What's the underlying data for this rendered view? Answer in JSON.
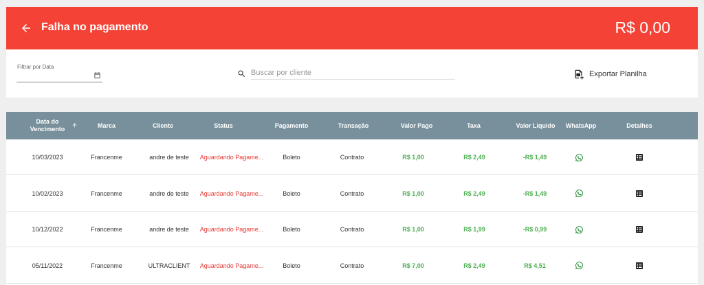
{
  "header": {
    "title": "Falha no pagamento",
    "amount": "R$ 0,00"
  },
  "filters": {
    "date_label": "Filtrar por Data",
    "search_placeholder": "Buscar por cliente",
    "export_label": "Exportar Planilha"
  },
  "table": {
    "columns": {
      "vencimento_line1": "Data do",
      "vencimento_line2": "Vencimento",
      "marca": "Marca",
      "cliente": "Cliente",
      "status": "Status",
      "pagamento": "Pagamento",
      "transacao": "Transação",
      "valor_pago": "Valor Pago",
      "taxa": "Taxa",
      "valor_liquido": "Valor Líquido",
      "whatsapp": "WhatsApp",
      "detalhes": "Detalhes"
    },
    "rows": [
      {
        "vencimento": "10/03/2023",
        "marca": "Francenme",
        "cliente": "andre de teste",
        "status": "Aguardando Pagame...",
        "pagamento": "Boleto",
        "transacao": "Contrato",
        "valor_pago": "R$ 1,00",
        "taxa": "R$ 2,49",
        "valor_liquido": "-R$ 1,49"
      },
      {
        "vencimento": "10/02/2023",
        "marca": "Francenme",
        "cliente": "andre de teste",
        "status": "Aguardando Pagame...",
        "pagamento": "Boleto",
        "transacao": "Contrato",
        "valor_pago": "R$ 1,00",
        "taxa": "R$ 2,49",
        "valor_liquido": "-R$ 1,49"
      },
      {
        "vencimento": "10/12/2022",
        "marca": "Francenme",
        "cliente": "andre de teste",
        "status": "Aguardando Pagame...",
        "pagamento": "Boleto",
        "transacao": "Contrato",
        "valor_pago": "R$ 1,00",
        "taxa": "R$ 1,99",
        "valor_liquido": "-R$ 0,99"
      },
      {
        "vencimento": "05/11/2022",
        "marca": "Francenme",
        "cliente": "ULTRACLIENT",
        "status": "Aguardando Pagame...",
        "pagamento": "Boleto",
        "transacao": "Contrato",
        "valor_pago": "R$ 7,00",
        "taxa": "R$ 2,49",
        "valor_liquido": "R$ 4,51"
      }
    ]
  },
  "colors": {
    "header": "#f44336",
    "table_header": "#78909c",
    "positive": "#4caf50",
    "status": "#e53935"
  },
  "icons": {
    "back": "arrow-left-icon",
    "calendar": "calendar-icon",
    "search": "search-icon",
    "export": "spreadsheet-export-icon",
    "sort": "arrow-up-icon",
    "whatsapp": "whatsapp-icon",
    "details": "details-list-icon"
  }
}
